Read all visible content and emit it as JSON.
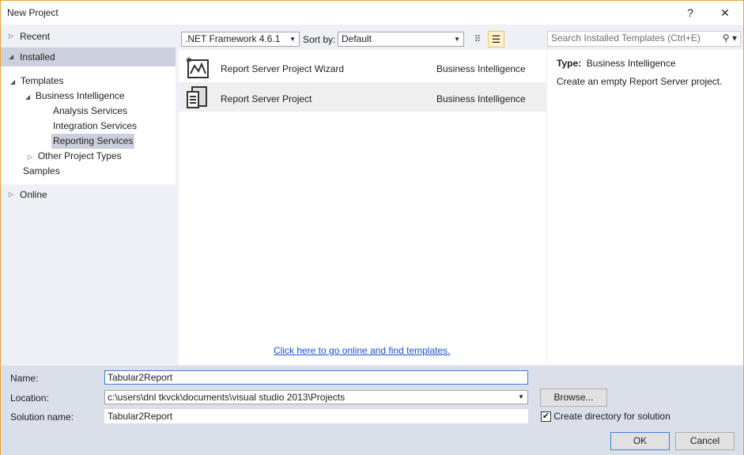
{
  "window": {
    "title": "New Project",
    "help": "?",
    "close": "✕"
  },
  "sidebar": {
    "recent": "Recent",
    "installed": "Installed",
    "online": "Online",
    "tree": {
      "templates": "Templates",
      "business_intelligence": "Business Intelligence",
      "analysis": "Analysis Services",
      "integration": "Integration Services",
      "reporting": "Reporting Services",
      "other": "Other Project Types",
      "samples": "Samples"
    }
  },
  "toolbar": {
    "framework": ".NET Framework 4.6.1",
    "sort_label": "Sort by:",
    "sort_value": "Default",
    "search_placeholder": "Search Installed Templates (Ctrl+E)"
  },
  "templates": [
    {
      "name": "Report Server Project Wizard",
      "category": "Business Intelligence",
      "icon": "report-wizard-icon"
    },
    {
      "name": "Report Server Project",
      "category": "Business Intelligence",
      "icon": "report-project-icon"
    }
  ],
  "online_link": "Click here to go online and find templates.",
  "details": {
    "type_label": "Type:",
    "type_value": "Business Intelligence",
    "description": "Create an empty Report Server project."
  },
  "form": {
    "name_label": "Name:",
    "name_value": "Tabular2Report",
    "location_label": "Location:",
    "location_value": "c:\\users\\dnl tkvck\\documents\\visual studio 2013\\Projects",
    "solution_label": "Solution name:",
    "solution_value": "Tabular2Report",
    "browse": "Browse...",
    "create_dir": "Create directory for solution",
    "create_dir_checked": true,
    "ok": "OK",
    "cancel": "Cancel"
  },
  "colors": {
    "accent": "#e8a33c",
    "selection": "#ccd0dc",
    "link": "#1a4fd6"
  }
}
